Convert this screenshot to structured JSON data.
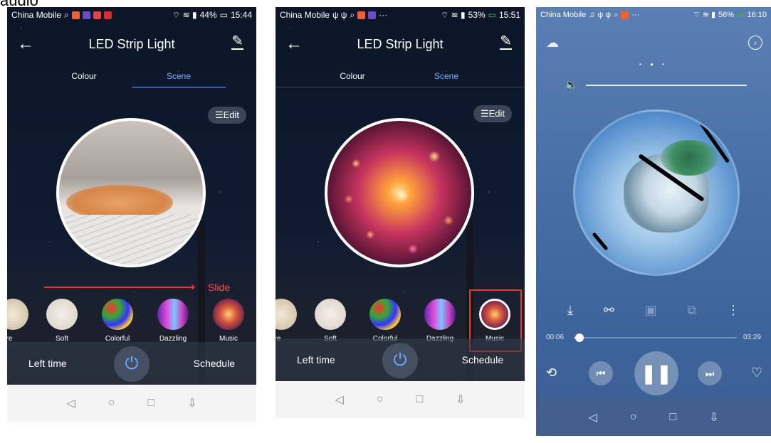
{
  "caption": "audio",
  "phone1": {
    "status": {
      "carrier": "China Mobile",
      "right": "44%",
      "time": "15:44"
    },
    "title": "LED Strip Light",
    "tabs": [
      "Colour",
      "Scene"
    ],
    "edit_label": "Edit",
    "slide_label": "Slide",
    "scenes": [
      "sure",
      "Soft",
      "Colorful",
      "Dazzling",
      "Music"
    ],
    "left_time": "Left time",
    "schedule": "Schedule"
  },
  "phone2": {
    "status": {
      "carrier": "China Mobile",
      "right": "53%",
      "time": "15:51"
    },
    "title": "LED Strip Light",
    "tabs": [
      "Colour",
      "Scene"
    ],
    "edit_label": "Edit",
    "scenes": [
      "sure",
      "Soft",
      "Colorful",
      "Dazzling",
      "Music"
    ],
    "left_time": "Left time",
    "schedule": "Schedule"
  },
  "phone3": {
    "status": {
      "carrier": "China Mobile",
      "right": "56%",
      "time": "16:10"
    },
    "time_start": "00:06",
    "time_end": "03:29",
    "progress": 0.03
  },
  "icons": {
    "back": "arrow-left-icon",
    "pen": "pen-icon",
    "power": "power-icon",
    "play_pause": "pause-icon"
  },
  "colors": {
    "accent_blue": "#7fb0ff",
    "highlight_red": "#e33333",
    "nav_bg": "#f4f4f4"
  }
}
